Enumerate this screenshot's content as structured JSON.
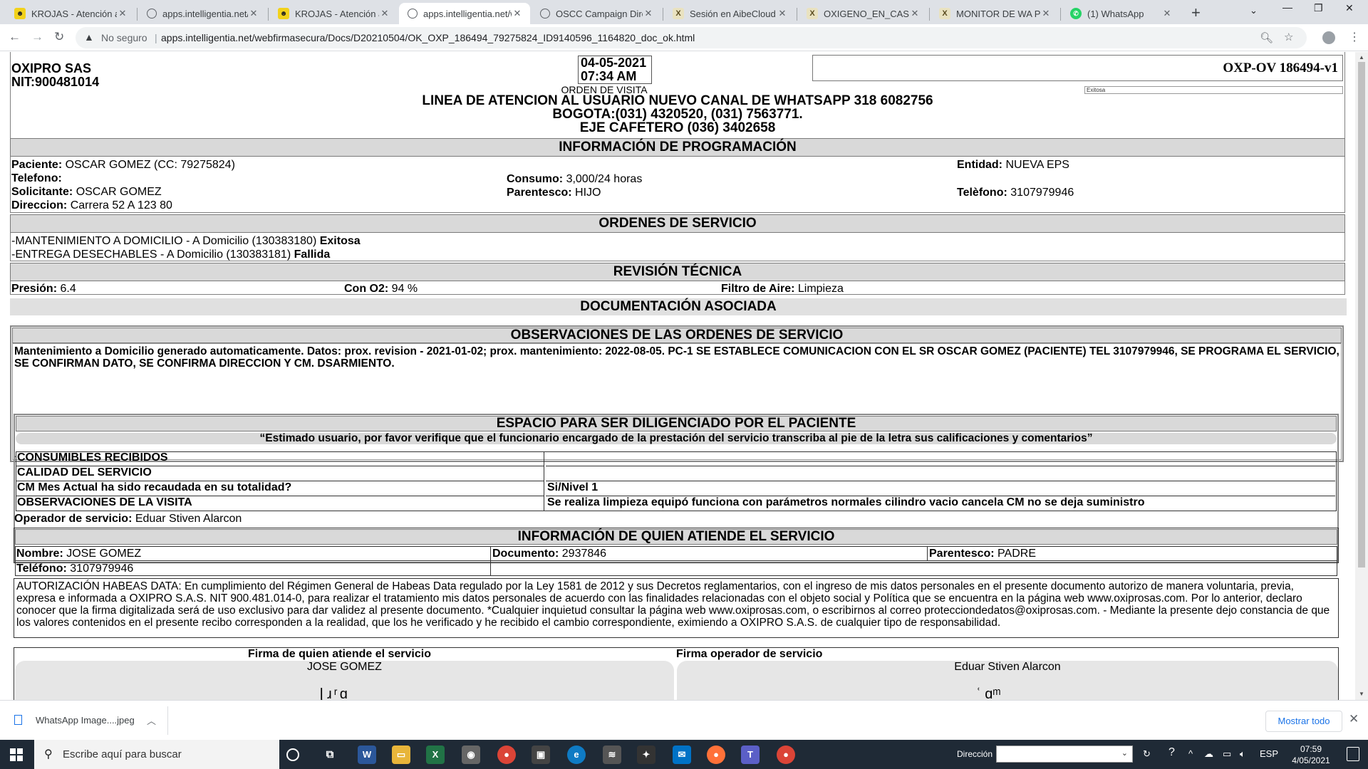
{
  "browser": {
    "tabs": [
      {
        "label": "KROJAS - Atención al U",
        "icon": "yellow-logo-icon",
        "active": false
      },
      {
        "label": "apps.intelligentia.net/w",
        "icon": "globe-icon",
        "active": false
      },
      {
        "label": "KROJAS - Atención al U",
        "icon": "yellow-logo-icon",
        "active": false
      },
      {
        "label": "apps.intelligentia.net/w",
        "icon": "globe-icon",
        "active": true
      },
      {
        "label": "OSCC Campaign Direc",
        "icon": "globe-icon",
        "active": false
      },
      {
        "label": "Sesión en AibeCloud",
        "icon": "x-logo-icon",
        "active": false
      },
      {
        "label": "OXIGENO_EN_CASA (S",
        "icon": "x-logo-icon",
        "active": false
      },
      {
        "label": "MONITOR DE WA PEN",
        "icon": "x-logo-icon",
        "active": false
      },
      {
        "label": "(1) WhatsApp",
        "icon": "whatsapp-icon",
        "active": false
      }
    ],
    "security_label": "No seguro",
    "url": "apps.intelligentia.net/webfirmasecura/Docs/D20210504/OK_OXP_186494_79275824_ID9140596_1164820_doc_ok.html"
  },
  "doc": {
    "company": "OXIPRO SAS",
    "nit": "NIT:900481014",
    "date": "04-05-2021",
    "time": "07:34 AM",
    "code": "OXP-OV 186494-v1",
    "status_small": "Exitosa",
    "doc_type": "ORDEN DE VISITA",
    "line1": "LINEA DE ATENCION AL USUARIO NUEVO CANAL DE WHATSAPP 318 6082756",
    "line2": "BOGOTA:(031) 4320520, (031) 7563771.",
    "line3": "EJE CAFETERO (036) 3402658",
    "programacion": {
      "title": "INFORMACIÓN DE PROGRAMACIÓN",
      "paciente_label": "Paciente:",
      "paciente": "OSCAR GOMEZ (CC: 79275824)",
      "telefono_label": "Telefono:",
      "telefono": "",
      "solicitante_label": "Solicitante:",
      "solicitante": "OSCAR GOMEZ",
      "direccion_label": "Direccion:",
      "direccion": "Carrera 52 A 123 80",
      "consumo_label": "Consumo:",
      "consumo": "3,000/24 horas",
      "parentesco_label": "Parentesco:",
      "parentesco": "HIJO",
      "entidad_label": "Entidad:",
      "entidad": "NUEVA EPS",
      "telefono2_label": "Telèfono:",
      "telefono2": "3107979946"
    },
    "ordenes": {
      "title": "ORDENES DE SERVICIO",
      "items": [
        {
          "text": "-MANTENIMIENTO A DOMICILIO - A Domicilio (130383180)",
          "status": "Exitosa"
        },
        {
          "text": "-ENTREGA DESECHABLES - A Domicilio (130383181)",
          "status": "Fallida"
        }
      ]
    },
    "revision": {
      "title": "REVISIÓN TÉCNICA",
      "presion_label": "Presión:",
      "presion": "6.4",
      "cono2_label": "Con O2:",
      "cono2": "94 %",
      "filtro_label": "Filtro de Aire:",
      "filtro": "Limpieza"
    },
    "documentacion_title": "DOCUMENTACIÓN ASOCIADA",
    "observaciones": {
      "title": "OBSERVACIONES DE LAS ORDENES DE SERVICIO",
      "text": "Mantenimiento a Domicilio generado automaticamente. Datos: prox. revision - 2021-01-02; prox. mantenimiento: 2022-08-05. PC-1 SE ESTABLECE COMUNICACION CON EL SR OSCAR GOMEZ (PACIENTE) TEL 3107979946, SE PROGRAMA EL SERVICIO, SE CONFIRMAN DATO, SE CONFIRMA DIRECCION Y CM. DSARMIENTO.",
      "dot": "."
    },
    "paciente_espacio": {
      "title": "ESPACIO PARA SER DILIGENCIADO POR EL PACIENTE",
      "subtitle": "“Estimado usuario, por favor verifique que el funcionario encargado de la prestación del servicio transcriba al pie de la letra sus calificaciones y comentarios”",
      "rows": [
        {
          "label": "CONSUMIBLES RECIBIDOS",
          "value": ""
        },
        {
          "label": "CALIDAD DEL SERVICIO",
          "value": ""
        },
        {
          "label": "CM Mes Actual ha sido recaudada en su totalidad?",
          "value": "Si/Nivel 1"
        },
        {
          "label": "OBSERVACIONES DE LA VISITA",
          "value": "Se realiza limpieza equipó funciona con parámetros normales cilindro vacio cancela CM no se deja suministro"
        }
      ],
      "operador_label": "Operador de servicio:",
      "operador": "Eduar Stiven Alarcon"
    },
    "atiende": {
      "title": "INFORMACIÓN DE QUIEN ATIENDE EL SERVICIO",
      "nombre_label": "Nombre:",
      "nombre": "JOSE GOMEZ",
      "documento_label": "Documento:",
      "documento": "2937846",
      "parentesco_label": "Parentesco:",
      "parentesco": "PADRE",
      "telefono_label": "Teléfono:",
      "telefono": "3107979946"
    },
    "habeas": "AUTORIZACIÓN HABEAS DATA: En cumplimiento del Régimen General de Habeas Data regulado por la Ley 1581 de 2012 y sus Decretos reglamentarios, con el ingreso de mis datos personales en el presente documento autorizo de manera voluntaria, previa, expresa e informada a OXIPRO S.A.S. NIT 900.481.014-0, para realizar el tratamiento mis datos personales de acuerdo con las finalidades relacionadas con el objeto social y Política que se encuentra en la página web www.oxiprosas.com. Por lo anterior, declaro conocer que la firma digitalizada será de uso exclusivo para dar validez al presente documento. *Cualquier inquietud consultar la página web www.oxiprosas.com, o escribirnos al correo protecciondedatos@oxiprosas.com. - Mediante la presente dejo constancia de que los valores contenidos en el presente recibo corresponden a la realidad, que los he verificado y he recibido el cambio correspondiente, eximiendo a OXIPRO S.A.S. de cualquier tipo de responsabilidad.",
    "firma": {
      "left_title": "Firma de quien atiende el servicio",
      "left_name": "JOSE GOMEZ",
      "right_title": "Firma operador de servicio",
      "right_name": "Eduar Stiven Alarcon"
    }
  },
  "downloads": {
    "file": "WhatsApp Image....jpeg",
    "show_all": "Mostrar todo"
  },
  "taskbar": {
    "search_placeholder": "Escribe aquí para buscar",
    "address_label": "Dirección",
    "lang": "ESP",
    "time": "07:59",
    "date": "4/05/2021"
  }
}
